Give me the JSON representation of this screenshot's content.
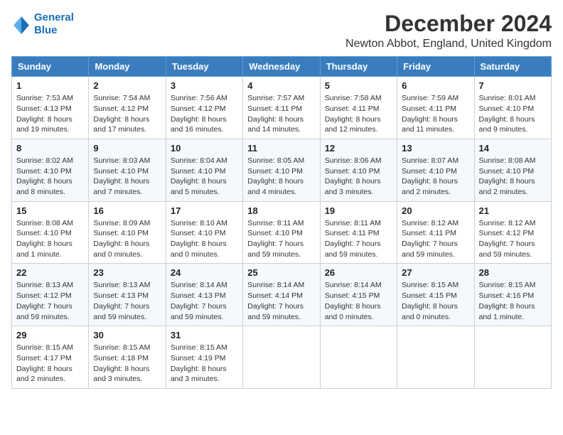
{
  "logo": {
    "line1": "General",
    "line2": "Blue"
  },
  "title": "December 2024",
  "subtitle": "Newton Abbot, England, United Kingdom",
  "days_of_week": [
    "Sunday",
    "Monday",
    "Tuesday",
    "Wednesday",
    "Thursday",
    "Friday",
    "Saturday"
  ],
  "weeks": [
    [
      {
        "day": "1",
        "sunrise": "Sunrise: 7:53 AM",
        "sunset": "Sunset: 4:13 PM",
        "daylight": "Daylight: 8 hours and 19 minutes."
      },
      {
        "day": "2",
        "sunrise": "Sunrise: 7:54 AM",
        "sunset": "Sunset: 4:12 PM",
        "daylight": "Daylight: 8 hours and 17 minutes."
      },
      {
        "day": "3",
        "sunrise": "Sunrise: 7:56 AM",
        "sunset": "Sunset: 4:12 PM",
        "daylight": "Daylight: 8 hours and 16 minutes."
      },
      {
        "day": "4",
        "sunrise": "Sunrise: 7:57 AM",
        "sunset": "Sunset: 4:11 PM",
        "daylight": "Daylight: 8 hours and 14 minutes."
      },
      {
        "day": "5",
        "sunrise": "Sunrise: 7:58 AM",
        "sunset": "Sunset: 4:11 PM",
        "daylight": "Daylight: 8 hours and 12 minutes."
      },
      {
        "day": "6",
        "sunrise": "Sunrise: 7:59 AM",
        "sunset": "Sunset: 4:11 PM",
        "daylight": "Daylight: 8 hours and 11 minutes."
      },
      {
        "day": "7",
        "sunrise": "Sunrise: 8:01 AM",
        "sunset": "Sunset: 4:10 PM",
        "daylight": "Daylight: 8 hours and 9 minutes."
      }
    ],
    [
      {
        "day": "8",
        "sunrise": "Sunrise: 8:02 AM",
        "sunset": "Sunset: 4:10 PM",
        "daylight": "Daylight: 8 hours and 8 minutes."
      },
      {
        "day": "9",
        "sunrise": "Sunrise: 8:03 AM",
        "sunset": "Sunset: 4:10 PM",
        "daylight": "Daylight: 8 hours and 7 minutes."
      },
      {
        "day": "10",
        "sunrise": "Sunrise: 8:04 AM",
        "sunset": "Sunset: 4:10 PM",
        "daylight": "Daylight: 8 hours and 5 minutes."
      },
      {
        "day": "11",
        "sunrise": "Sunrise: 8:05 AM",
        "sunset": "Sunset: 4:10 PM",
        "daylight": "Daylight: 8 hours and 4 minutes."
      },
      {
        "day": "12",
        "sunrise": "Sunrise: 8:06 AM",
        "sunset": "Sunset: 4:10 PM",
        "daylight": "Daylight: 8 hours and 3 minutes."
      },
      {
        "day": "13",
        "sunrise": "Sunrise: 8:07 AM",
        "sunset": "Sunset: 4:10 PM",
        "daylight": "Daylight: 8 hours and 2 minutes."
      },
      {
        "day": "14",
        "sunrise": "Sunrise: 8:08 AM",
        "sunset": "Sunset: 4:10 PM",
        "daylight": "Daylight: 8 hours and 2 minutes."
      }
    ],
    [
      {
        "day": "15",
        "sunrise": "Sunrise: 8:08 AM",
        "sunset": "Sunset: 4:10 PM",
        "daylight": "Daylight: 8 hours and 1 minute."
      },
      {
        "day": "16",
        "sunrise": "Sunrise: 8:09 AM",
        "sunset": "Sunset: 4:10 PM",
        "daylight": "Daylight: 8 hours and 0 minutes."
      },
      {
        "day": "17",
        "sunrise": "Sunrise: 8:10 AM",
        "sunset": "Sunset: 4:10 PM",
        "daylight": "Daylight: 8 hours and 0 minutes."
      },
      {
        "day": "18",
        "sunrise": "Sunrise: 8:11 AM",
        "sunset": "Sunset: 4:10 PM",
        "daylight": "Daylight: 7 hours and 59 minutes."
      },
      {
        "day": "19",
        "sunrise": "Sunrise: 8:11 AM",
        "sunset": "Sunset: 4:11 PM",
        "daylight": "Daylight: 7 hours and 59 minutes."
      },
      {
        "day": "20",
        "sunrise": "Sunrise: 8:12 AM",
        "sunset": "Sunset: 4:11 PM",
        "daylight": "Daylight: 7 hours and 59 minutes."
      },
      {
        "day": "21",
        "sunrise": "Sunrise: 8:12 AM",
        "sunset": "Sunset: 4:12 PM",
        "daylight": "Daylight: 7 hours and 59 minutes."
      }
    ],
    [
      {
        "day": "22",
        "sunrise": "Sunrise: 8:13 AM",
        "sunset": "Sunset: 4:12 PM",
        "daylight": "Daylight: 7 hours and 59 minutes."
      },
      {
        "day": "23",
        "sunrise": "Sunrise: 8:13 AM",
        "sunset": "Sunset: 4:13 PM",
        "daylight": "Daylight: 7 hours and 59 minutes."
      },
      {
        "day": "24",
        "sunrise": "Sunrise: 8:14 AM",
        "sunset": "Sunset: 4:13 PM",
        "daylight": "Daylight: 7 hours and 59 minutes."
      },
      {
        "day": "25",
        "sunrise": "Sunrise: 8:14 AM",
        "sunset": "Sunset: 4:14 PM",
        "daylight": "Daylight: 7 hours and 59 minutes."
      },
      {
        "day": "26",
        "sunrise": "Sunrise: 8:14 AM",
        "sunset": "Sunset: 4:15 PM",
        "daylight": "Daylight: 8 hours and 0 minutes."
      },
      {
        "day": "27",
        "sunrise": "Sunrise: 8:15 AM",
        "sunset": "Sunset: 4:15 PM",
        "daylight": "Daylight: 8 hours and 0 minutes."
      },
      {
        "day": "28",
        "sunrise": "Sunrise: 8:15 AM",
        "sunset": "Sunset: 4:16 PM",
        "daylight": "Daylight: 8 hours and 1 minute."
      }
    ],
    [
      {
        "day": "29",
        "sunrise": "Sunrise: 8:15 AM",
        "sunset": "Sunset: 4:17 PM",
        "daylight": "Daylight: 8 hours and 2 minutes."
      },
      {
        "day": "30",
        "sunrise": "Sunrise: 8:15 AM",
        "sunset": "Sunset: 4:18 PM",
        "daylight": "Daylight: 8 hours and 3 minutes."
      },
      {
        "day": "31",
        "sunrise": "Sunrise: 8:15 AM",
        "sunset": "Sunset: 4:19 PM",
        "daylight": "Daylight: 8 hours and 3 minutes."
      },
      null,
      null,
      null,
      null
    ]
  ]
}
